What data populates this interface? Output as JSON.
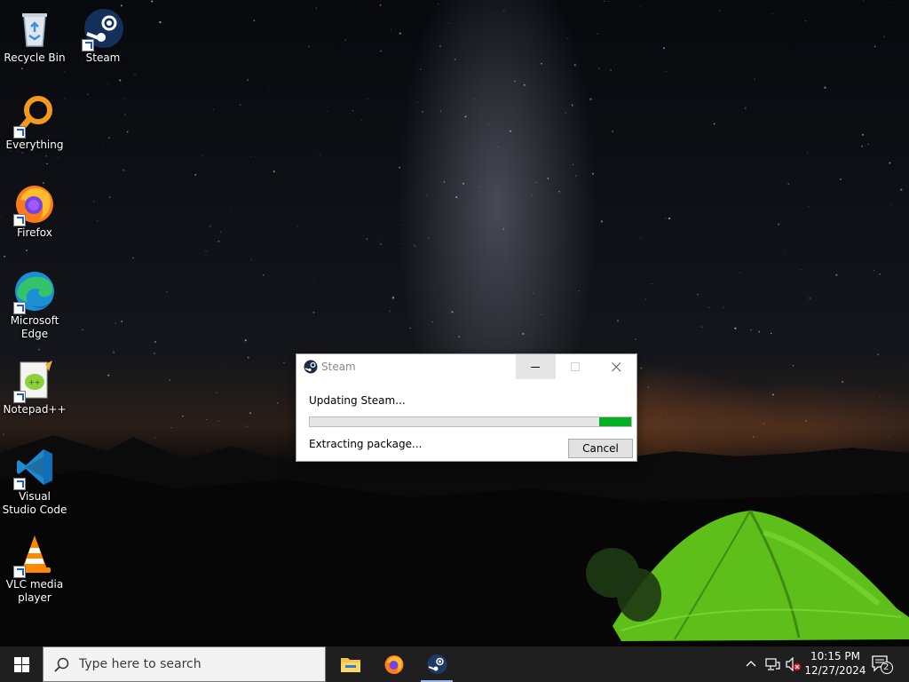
{
  "desktop": {
    "icons": [
      {
        "label": "Recycle Bin",
        "icon": "recycle-bin-icon"
      },
      {
        "label": "Steam",
        "icon": "steam-icon"
      },
      {
        "label": "Everything",
        "icon": "everything-search-icon"
      },
      {
        "label": "Firefox",
        "icon": "firefox-icon"
      },
      {
        "label": "Microsoft Edge",
        "icon": "edge-icon"
      },
      {
        "label": "Notepad++",
        "icon": "notepad-plus-plus-icon"
      },
      {
        "label": "Visual Studio Code",
        "icon": "vscode-icon"
      },
      {
        "label": "VLC media player",
        "icon": "vlc-icon"
      }
    ]
  },
  "dialog": {
    "title": "Steam",
    "message": "Updating Steam...",
    "progress_fraction": 0.9,
    "status": "Extracting package...",
    "cancel_label": "Cancel",
    "colors": {
      "progress_fill": "#06b025",
      "titlebar_text": "#8a8a8a"
    }
  },
  "taskbar": {
    "search_placeholder": "Type here to search",
    "pinned_apps": [
      "file-explorer-icon",
      "firefox-icon",
      "steam-icon"
    ],
    "active_app": "steam-icon",
    "tray_icons": [
      "chevron-up-icon",
      "network-icon",
      "volume-muted-icon"
    ],
    "time": "10:15 PM",
    "date": "12/27/2024",
    "notification_count": "2"
  }
}
